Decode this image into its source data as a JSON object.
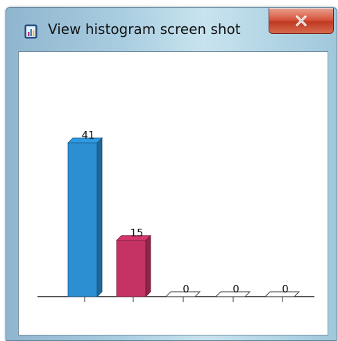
{
  "window": {
    "title": "View histogram screen shot",
    "icon": "histogram-app-icon",
    "close_button_icon": "close-icon"
  },
  "chart_data": {
    "type": "bar",
    "categories": [
      "",
      "",
      "",
      "",
      ""
    ],
    "values": [
      41,
      15,
      0,
      0,
      0
    ],
    "data_labels": [
      "41",
      "15",
      "0",
      "0",
      "0"
    ],
    "colors": [
      "#2b8fd2",
      "#c43363",
      "#ffffff",
      "#ffffff",
      "#ffffff"
    ],
    "ylim": [
      0,
      41
    ],
    "style": "3d-bars",
    "grid": false,
    "legend": "none",
    "title": "",
    "xlabel": "",
    "ylabel": ""
  }
}
